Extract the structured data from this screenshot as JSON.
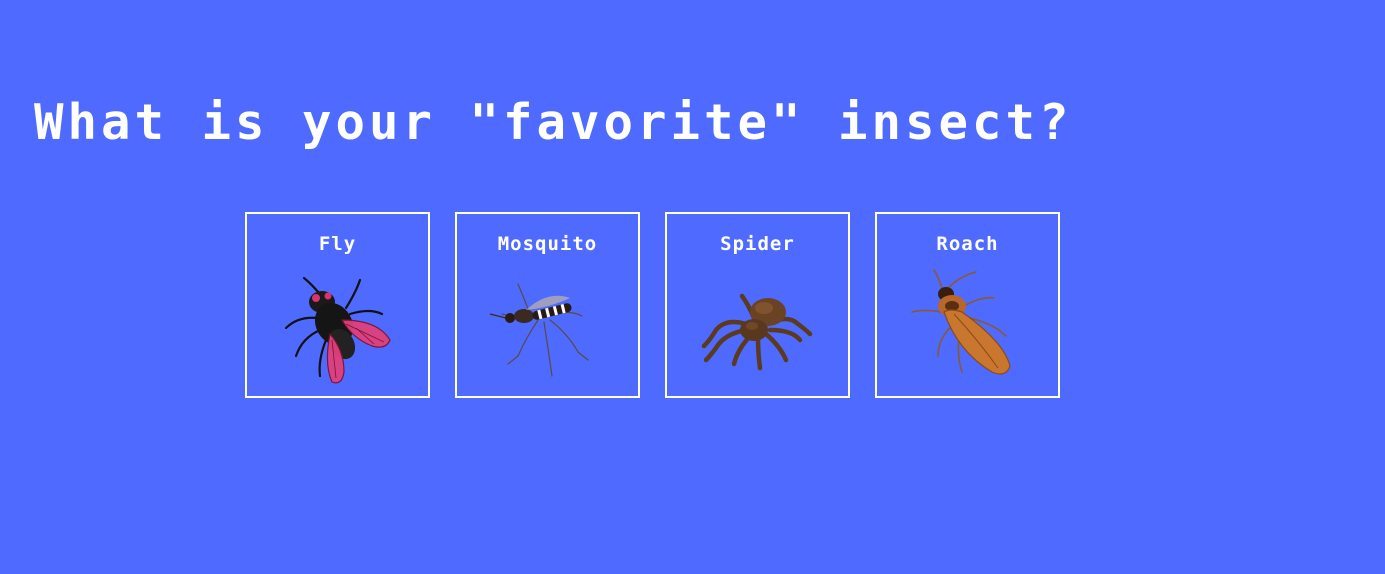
{
  "title": "What is your \"favorite\" insect?",
  "options": [
    {
      "label": "Fly",
      "icon": "fly-icon"
    },
    {
      "label": "Mosquito",
      "icon": "mosquito-icon"
    },
    {
      "label": "Spider",
      "icon": "spider-icon"
    },
    {
      "label": "Roach",
      "icon": "roach-icon"
    }
  ],
  "colors": {
    "background": "#4f6bff",
    "text": "#ffffff",
    "border": "#ffffff"
  }
}
